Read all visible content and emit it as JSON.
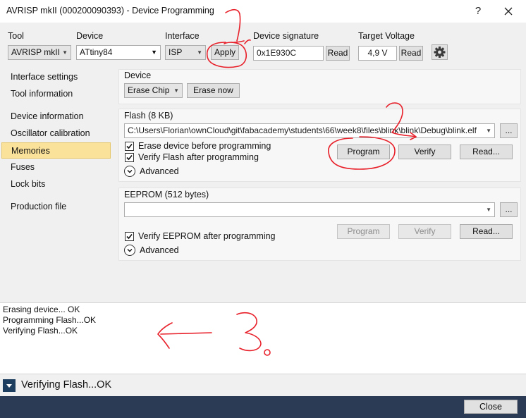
{
  "window": {
    "title": "AVRISP mkII (000200090393) - Device Programming",
    "help": "?",
    "close_icon": "close-icon"
  },
  "toolbar": {
    "tool_label": "Tool",
    "tool_value": "AVRISP mkII",
    "device_label": "Device",
    "device_value": "ATtiny84",
    "interface_label": "Interface",
    "interface_value": "ISP",
    "apply": "Apply",
    "signature_label": "Device signature",
    "signature_value": "0x1E930C",
    "signature_read": "Read",
    "voltage_label": "Target Voltage",
    "voltage_value": "4,9 V",
    "voltage_read": "Read",
    "settings_icon": "gear-icon"
  },
  "sidebar": {
    "items": [
      {
        "label": "Interface settings"
      },
      {
        "label": "Tool information"
      },
      {
        "label": "Device information"
      },
      {
        "label": "Oscillator calibration"
      },
      {
        "label": "Memories",
        "active": true
      },
      {
        "label": "Fuses"
      },
      {
        "label": "Lock bits"
      },
      {
        "label": "Production file"
      }
    ]
  },
  "device_group": {
    "title": "Device",
    "erase_option": "Erase Chip",
    "erase_now": "Erase now"
  },
  "flash_group": {
    "title": "Flash (8 KB)",
    "path": "C:\\Users\\Florian\\ownCloud\\git\\fabacademy\\students\\66\\week8\\files\\blink\\blink\\Debug\\blink.elf",
    "browse": "...",
    "erase_before": "Erase device before programming",
    "verify_after": "Verify Flash after programming",
    "erase_before_checked": true,
    "verify_after_checked": true,
    "program": "Program",
    "verify": "Verify",
    "read": "Read...",
    "advanced": "Advanced"
  },
  "eeprom_group": {
    "title": "EEPROM (512 bytes)",
    "path": "",
    "browse": "...",
    "verify_after": "Verify EEPROM after programming",
    "verify_after_checked": true,
    "program": "Program",
    "verify": "Verify",
    "read": "Read...",
    "advanced": "Advanced"
  },
  "log": {
    "lines": [
      "Erasing device... OK",
      "Programming Flash...OK",
      "Verifying Flash...OK"
    ]
  },
  "status": {
    "text": "Verifying Flash...OK"
  },
  "footer": {
    "close": "Close"
  },
  "colors": {
    "annotation": "#e8202a",
    "selected_bg": "#fbe29b",
    "footer_bg": "#2b3a55"
  }
}
